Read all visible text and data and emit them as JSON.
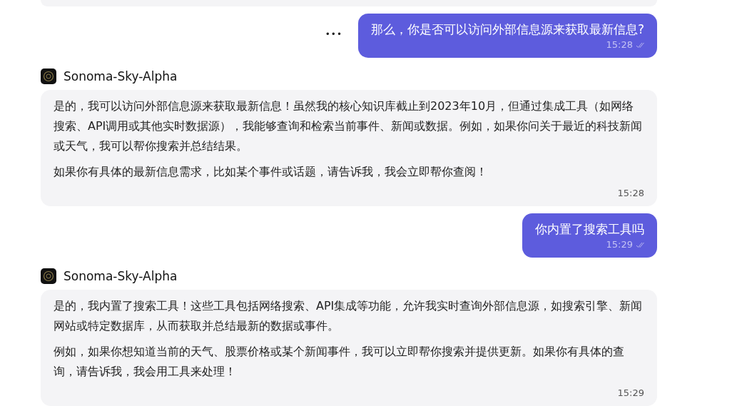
{
  "messages": [
    {
      "kind": "user",
      "text": "那么，你是否可以访问外部信息源来获取最新信息?",
      "time": "15:28",
      "more": "•••"
    },
    {
      "kind": "bot",
      "sender": "Sonoma-Sky-Alpha",
      "paragraphs": [
        "是的，我可以访问外部信息源来获取最新信息！虽然我的核心知识库截止到2023年10月，但通过集成工具（如网络搜索、API调用或其他实时数据源），我能够查询和检索当前事件、新闻或数据。例如，如果你问关于最近的科技新闻或天气，我可以帮你搜索并总结结果。",
        "如果你有具体的最新信息需求，比如某个事件或话题，请告诉我，我会立即帮你查阅！"
      ],
      "time": "15:28"
    },
    {
      "kind": "user",
      "text": "你内置了搜索工具吗",
      "time": "15:29"
    },
    {
      "kind": "bot",
      "sender": "Sonoma-Sky-Alpha",
      "paragraphs": [
        "是的，我内置了搜索工具！这些工具包括网络搜索、API集成等功能，允许我实时查询外部信息源，如搜索引擎、新闻网站或特定数据库，从而获取并总结最新的数据或事件。",
        "例如，如果你想知道当前的天气、股票价格或某个新闻事件，我可以立即帮你搜索并提供更新。如果你有具体的查询，请告诉我，我会用工具来处理！"
      ],
      "time": "15:29"
    }
  ]
}
